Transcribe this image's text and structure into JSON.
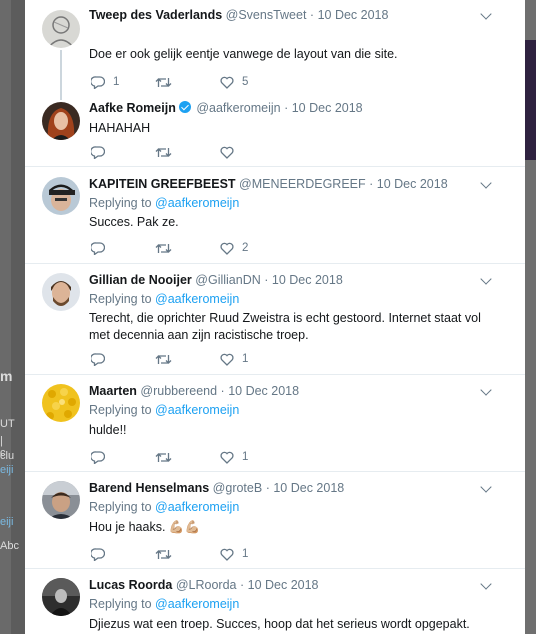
{
  "background": {
    "left_fragments": [
      "m",
      "UT",
      "| c",
      "clu",
      "eiji",
      "eiji",
      "Abc"
    ]
  },
  "tweets": [
    {
      "name": "Tweep des Vaderlands",
      "handle": "@SvensTweet",
      "sep": "·",
      "date": "10 Dec 2018",
      "verified": false,
      "replying_prefix": "",
      "replying_to": "",
      "text": "Doe er ook gelijk eentje vanwege de layout van die site.",
      "reply_count": "1",
      "retweet_count": "",
      "like_count": "5",
      "avatar": "avatar-sketch"
    },
    {
      "name": "Aafke Romeijn",
      "handle": "@aafkeromeijn",
      "sep": "·",
      "date": "10 Dec 2018",
      "verified": true,
      "replying_prefix": "",
      "replying_to": "",
      "text": "HAHAHAH",
      "reply_count": "",
      "retweet_count": "",
      "like_count": "",
      "avatar": "avatar-redhair"
    },
    {
      "name": "KAPITEIN GREEFBEEST",
      "handle": "@MENEERDEGREEF",
      "sep": "·",
      "date": "10 Dec 2018",
      "verified": false,
      "replying_prefix": "Replying to",
      "replying_to": "@aafkeromeijn",
      "text": "Succes. Pak ze.",
      "reply_count": "",
      "retweet_count": "",
      "like_count": "2",
      "avatar": "avatar-cap"
    },
    {
      "name": "Gillian de Nooijer",
      "handle": "@GillianDN",
      "sep": "·",
      "date": "10 Dec 2018",
      "verified": false,
      "replying_prefix": "Replying to",
      "replying_to": "@aafkeromeijn",
      "text": "Terecht, die oprichter Ruud Zweistra is echt gestoord. Internet staat vol met decennia aan zijn racistische troep.",
      "reply_count": "",
      "retweet_count": "",
      "like_count": "1",
      "avatar": "avatar-beard"
    },
    {
      "name": "Maarten",
      "handle": "@rubbereend",
      "sep": "·",
      "date": "10 Dec 2018",
      "verified": false,
      "replying_prefix": "Replying to",
      "replying_to": "@aafkeromeijn",
      "text": "hulde!!",
      "reply_count": "",
      "retweet_count": "",
      "like_count": "1",
      "avatar": "avatar-yellow"
    },
    {
      "name": "Barend Henselmans",
      "handle": "@groteB",
      "sep": "·",
      "date": "10 Dec 2018",
      "verified": false,
      "replying_prefix": "Replying to",
      "replying_to": "@aafkeromeijn",
      "text": "Hou je haaks. 💪🏼💪🏼",
      "reply_count": "",
      "retweet_count": "",
      "like_count": "1",
      "avatar": "avatar-photo"
    },
    {
      "name": "Lucas Roorda",
      "handle": "@LRoorda",
      "sep": "·",
      "date": "10 Dec 2018",
      "verified": false,
      "replying_prefix": "Replying to",
      "replying_to": "@aafkeromeijn",
      "text": "Djiezus wat een troep. Succes, hoop dat het serieus wordt opgepakt.",
      "reply_count": "",
      "retweet_count": "",
      "like_count": "",
      "avatar": "avatar-dark"
    }
  ],
  "colors": {
    "link": "#1da1f2",
    "text": "#14171a",
    "muted": "#657786",
    "divider": "#e6ecf0",
    "verified": "#1da1f2"
  },
  "icons": {
    "reply": "reply-icon",
    "retweet": "retweet-icon",
    "like": "heart-icon",
    "more": "chevron-down-icon",
    "verified": "verified-badge-icon"
  }
}
